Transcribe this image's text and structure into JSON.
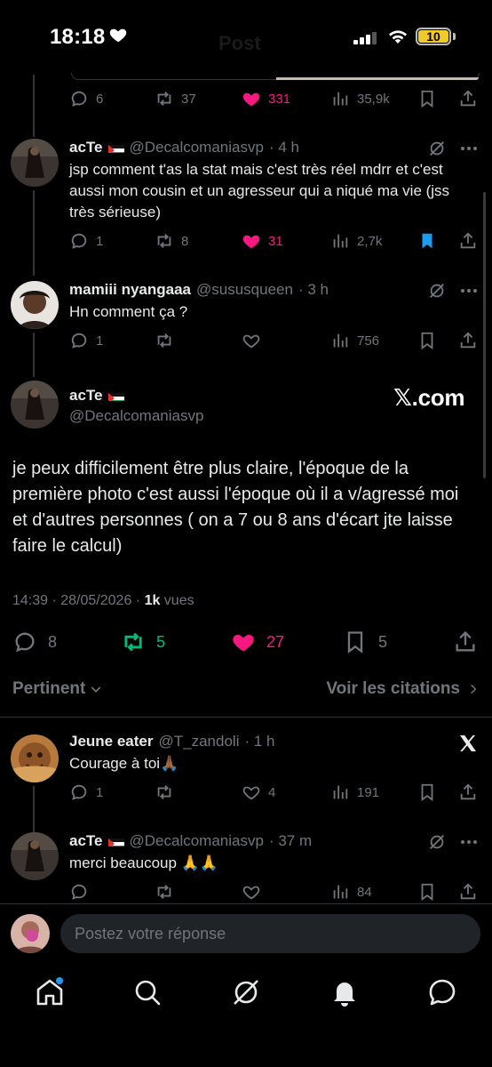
{
  "status_bar": {
    "time": "18:18",
    "battery": "10"
  },
  "ghost_title": "Post",
  "top_actions": {
    "replies": "6",
    "reposts": "37",
    "likes": "331",
    "views": "35,9k"
  },
  "replies": [
    {
      "name": "acTe",
      "handle": "@Decalcomaniasvp",
      "time": "· 4 h",
      "text": "jsp comment t'as la stat mais c'est très réel mdrr et c'est aussi mon cousin et un agresseur qui a niqué ma vie (jss très sérieuse)",
      "replies": "1",
      "reposts": "8",
      "likes": "31",
      "views": "2,7k"
    },
    {
      "name": "mamiii nyangaaa",
      "handle": "@sususqueen",
      "time": "· 3 h",
      "text": "Hn comment ça ?",
      "replies": "1",
      "reposts": "",
      "likes": "",
      "views": "756"
    }
  ],
  "main_tweet": {
    "name": "acTe",
    "handle": "@Decalcomaniasvp",
    "brand": "𝕏.com",
    "text": "je peux difficilement être plus claire, l'époque de la première photo c'est aussi l'époque où il a v/agressé moi et d'autres personnes ( on a 7 ou 8 ans d'écart jte laisse faire le calcul)",
    "timestamp": "14:39 · 28/05/2026 · ",
    "views_count": "1k",
    "views_label": " vues",
    "replies": "8",
    "reposts": "5",
    "likes": "27",
    "bookmarks": "5"
  },
  "sort": {
    "pertinent": "Pertinent",
    "citations": "Voir les citations"
  },
  "lower_replies": [
    {
      "name": "Jeune eater",
      "handle": "@T_zandoli",
      "time": "· 1 h",
      "text": "Courage à toi🙏🏾",
      "replies": "1",
      "reposts": "",
      "likes": "4",
      "views": "191"
    },
    {
      "name": "acTe",
      "handle": "@Decalcomaniasvp",
      "time": "· 37 m",
      "text": "merci beaucoup 🙏🙏",
      "replies": "",
      "reposts": "",
      "likes": "",
      "views": "84"
    }
  ],
  "compose": {
    "placeholder": "Postez votre réponse"
  },
  "colors": {
    "like": "#f91880",
    "repost": "#00ba7c",
    "bookmark": "#1d9bf0",
    "muted": "#71767b"
  },
  "icons": [
    "reply-icon",
    "repost-icon",
    "like-icon",
    "views-icon",
    "bookmark-icon",
    "share-icon",
    "grok-icon",
    "more-icon",
    "home-icon",
    "search-icon",
    "grok-tab-icon",
    "bell-icon",
    "messages-icon"
  ]
}
